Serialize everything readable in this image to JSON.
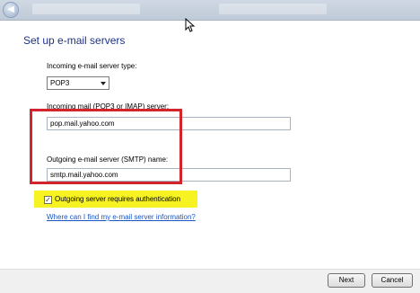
{
  "window": {
    "title_text": "",
    "back_icon": "arrow-left-icon",
    "cursor_icon": "mouse-pointer-icon"
  },
  "page": {
    "title": "Set up e-mail servers"
  },
  "form": {
    "incoming_type_label": "Incoming e-mail server type:",
    "incoming_type_value": "POP3",
    "incoming_server_label": "Incoming mail (POP3 or IMAP) server:",
    "incoming_server_value": "pop.mail.yahoo.com",
    "outgoing_server_label": "Outgoing e-mail server (SMTP) name:",
    "outgoing_server_value": "smtp.mail.yahoo.com",
    "auth_label": "Outgoing server requires authentication",
    "auth_checked": true,
    "help_link": "Where can I find my e-mail server information?"
  },
  "buttons": {
    "next": "Next",
    "cancel": "Cancel"
  },
  "colors": {
    "title_text": "#1e3287",
    "annotation_red": "#d3242c",
    "highlight_yellow": "#f7f323",
    "link_blue": "#1a55c6"
  }
}
